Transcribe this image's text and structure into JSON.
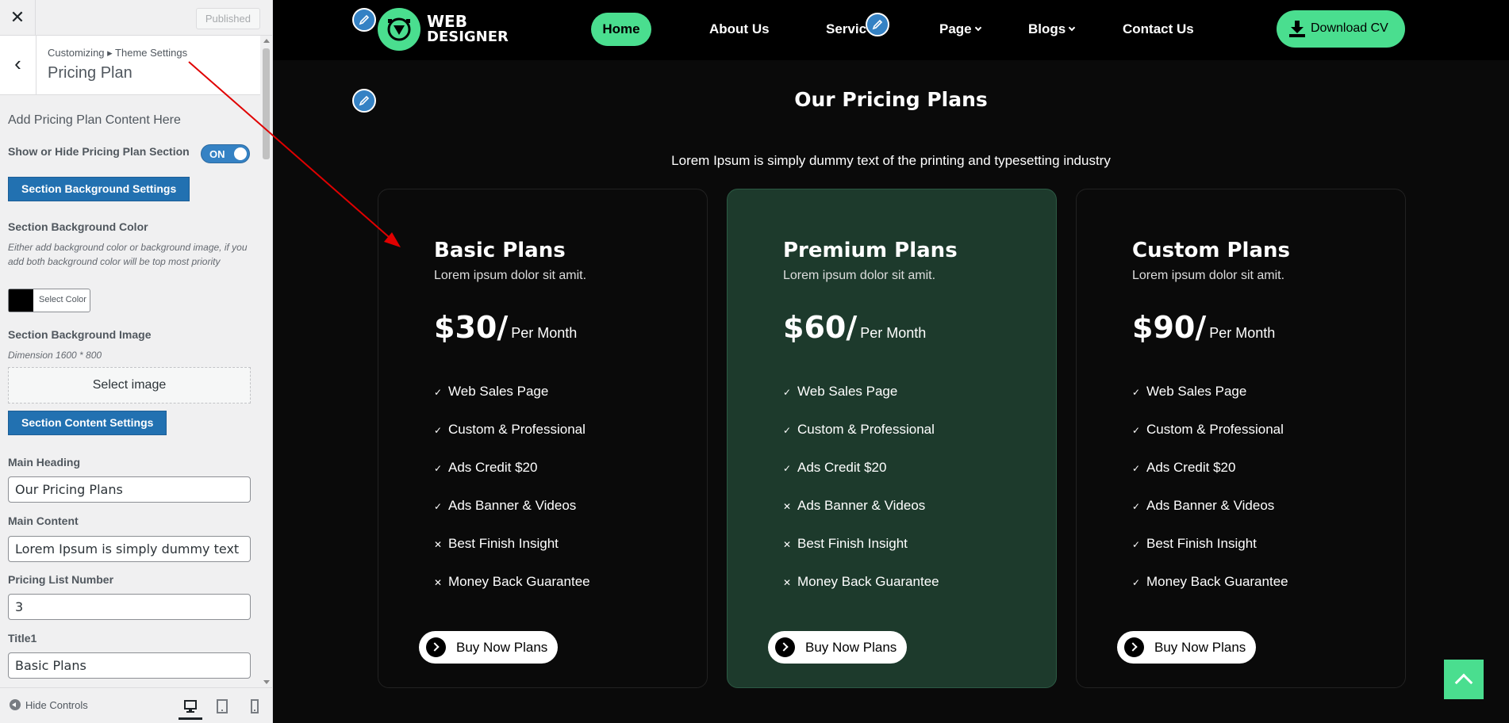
{
  "customizer": {
    "close_icon": "close-icon",
    "publish_label": "Published",
    "breadcrumb": "Customizing ▸ Theme Settings",
    "panel_title": "Pricing Plan",
    "intro": "Add Pricing Plan Content Here",
    "toggle_label": "Show or Hide Pricing Plan Section",
    "toggle_state": "ON",
    "bg_settings_button": "Section Background Settings",
    "bg_color_label": "Section Background Color",
    "bg_color_description": "Either add background color or background image, if you add both background color will be top most priority",
    "bg_color_value": "#000000",
    "select_color_label": "Select Color",
    "bg_image_label": "Section Background Image",
    "bg_image_dimension": "Dimension 1600 * 800",
    "select_image_label": "Select image",
    "content_settings_button": "Section Content Settings",
    "main_heading_label": "Main Heading",
    "main_heading_value": "Our Pricing Plans",
    "main_content_label": "Main Content",
    "main_content_value": "Lorem Ipsum is simply dummy text of the",
    "pricing_list_label": "Pricing List Number",
    "pricing_list_value": "3",
    "title1_label": "Title1",
    "title1_value": "Basic Plans",
    "hide_controls_label": "Hide Controls",
    "devices": [
      "desktop",
      "tablet",
      "mobile"
    ]
  },
  "site": {
    "logo_line1": "WEB",
    "logo_line2": "DESIGNER",
    "nav": {
      "home": "Home",
      "about": "About Us",
      "services": "Servic",
      "page": "Page",
      "blogs": "Blogs",
      "contact": "Contact Us"
    },
    "download_label": "Download CV",
    "pricing_heading": "Our Pricing Plans",
    "pricing_subheading": "Lorem Ipsum is simply dummy text of the printing and typesetting industry",
    "accent_color": "#4ade8f",
    "featured_card_color": "#1d3a2c",
    "plans": [
      {
        "title": "Basic Plans",
        "subtitle": "Lorem ipsum dolor sit amit.",
        "price": "$30/",
        "period": "Per Month",
        "button": "Buy Now Plans",
        "features": [
          {
            "label": "Web Sales Page",
            "included": true
          },
          {
            "label": "Custom & Professional",
            "included": true
          },
          {
            "label": "Ads Credit $20",
            "included": true
          },
          {
            "label": "Ads Banner & Videos",
            "included": true
          },
          {
            "label": "Best Finish Insight",
            "included": false
          },
          {
            "label": "Money Back Guarantee",
            "included": false
          }
        ]
      },
      {
        "title": "Premium Plans",
        "subtitle": "Lorem ipsum dolor sit amit.",
        "price": "$60/",
        "period": "Per Month",
        "button": "Buy Now Plans",
        "features": [
          {
            "label": "Web Sales Page",
            "included": true
          },
          {
            "label": "Custom & Professional",
            "included": true
          },
          {
            "label": "Ads Credit $20",
            "included": true
          },
          {
            "label": "Ads Banner & Videos",
            "included": false
          },
          {
            "label": "Best Finish Insight",
            "included": false
          },
          {
            "label": "Money Back Guarantee",
            "included": false
          }
        ]
      },
      {
        "title": "Custom Plans",
        "subtitle": "Lorem ipsum dolor sit amit.",
        "price": "$90/",
        "period": "Per Month",
        "button": "Buy Now Plans",
        "features": [
          {
            "label": "Web Sales Page",
            "included": true
          },
          {
            "label": "Custom & Professional",
            "included": true
          },
          {
            "label": "Ads Credit $20",
            "included": true
          },
          {
            "label": "Ads Banner & Videos",
            "included": true
          },
          {
            "label": "Best Finish Insight",
            "included": true
          },
          {
            "label": "Money Back Guarantee",
            "included": true
          }
        ]
      }
    ]
  },
  "icons": {
    "included_mark": "✓",
    "excluded_mark": "✕"
  }
}
